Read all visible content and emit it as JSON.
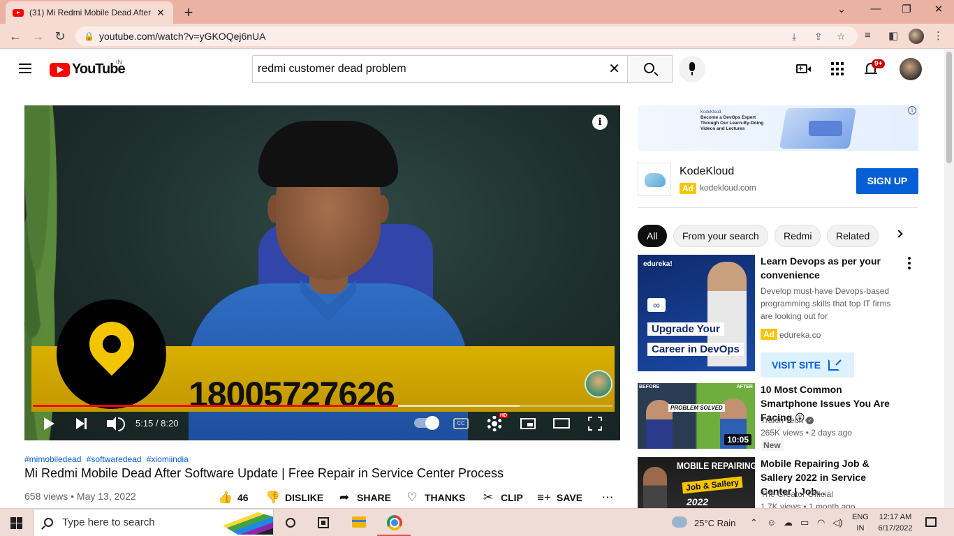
{
  "browser": {
    "tab_title": "(31) Mi Redmi Mobile Dead After",
    "url": "youtube.com/watch?v=yGKOQej6nUA",
    "tab_close_glyph": "✕",
    "new_tab_glyph": "+"
  },
  "youtube": {
    "logo_text": "YouTube",
    "country_code": "IN",
    "search_query": "redmi customer dead problem",
    "notification_count": "9+"
  },
  "player": {
    "overlay_number": "18005727626",
    "time": "5:15 / 8:20",
    "progress_played_fraction": 0.63,
    "progress_loaded_fraction": 0.84,
    "hd_label": "HD",
    "cc_label": "CC"
  },
  "video": {
    "hashtags": [
      "#mimobiledead",
      "#softwaredead",
      "#xiomiindia"
    ],
    "title": "Mi Redmi Mobile Dead After Software Update | Free Repair in Service Center Process",
    "views_date": "658 views • May 13, 2022",
    "actions": {
      "like_count": "46",
      "dislike": "DISLIKE",
      "share": "SHARE",
      "thanks": "THANKS",
      "clip": "CLIP",
      "save": "SAVE"
    }
  },
  "sidebar": {
    "ad_banner_text": {
      "brand": "KodeKloud",
      "headline_1": "Become a DevOps Expert",
      "headline_2": "Through Our Learn-By-Doing",
      "headline_3": "Videos and Lectures"
    },
    "ad": {
      "name": "KodeKloud",
      "badge": "Ad",
      "domain": "kodekloud.com",
      "cta": "SIGN UP"
    },
    "chips": [
      "All",
      "From your search",
      "Redmi",
      "Related"
    ],
    "recommendations": [
      {
        "title": "Learn Devops as per your convenience",
        "description": "Develop must-have Devops-based programming skills that top IT firms are looking out for",
        "ad_badge": "Ad",
        "domain": "edureka.co",
        "cta": "VISIT SITE",
        "thumb_line1": "Upgrade Your",
        "thumb_line2": "Career in DevOps",
        "thumb_brand": "edureka!"
      },
      {
        "title": "10 Most Common Smartphone Issues You Are Facing 😲...",
        "channel": "Trakin Tech",
        "meta": "265K views • 2 days ago",
        "badge": "New",
        "duration": "10:05",
        "thumb_label": "PROBLEM SOLVED",
        "thumb_before": "BEFORE",
        "thumb_after": "AFTER"
      },
      {
        "title": "Mobile Repairing Job & Sallery 2022 in Service Center | Job...",
        "channel": "The Creator Official",
        "meta": "1.7K views • 1 month ago",
        "thumb_line1": "MOBILE REPAIRING",
        "thumb_line2": "Job & Sallery",
        "thumb_line3": "2022"
      }
    ]
  },
  "taskbar": {
    "search_placeholder": "Type here to search",
    "weather": "25°C  Rain",
    "lang_1": "ENG",
    "lang_2": "IN",
    "time": "12:17 AM",
    "date": "6/17/2022"
  },
  "colors": {
    "youtube_red": "#ff0000",
    "link_blue": "#065fd4",
    "banner_yellow": "#d9b000",
    "tabstrip": "#e9b2a3"
  }
}
